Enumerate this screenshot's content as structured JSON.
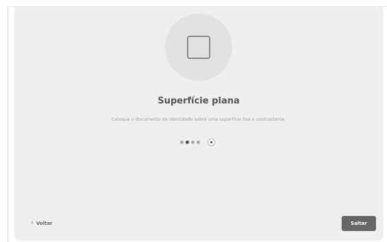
{
  "step": {
    "title": "Superfície plana",
    "description": "Coloque o documento de identidade sobre uma superfície lisa e contrastante."
  },
  "pager": {
    "total": 4,
    "active_index": 2
  },
  "navigation": {
    "back_label": "Voltar",
    "back_icon": "‹",
    "skip_label": "Saltar"
  },
  "colors": {
    "card_background": "#efefef",
    "skip_button": "#666666",
    "dot_active": "#4a4a4a",
    "dot_inactive": "#a8a8a8"
  }
}
